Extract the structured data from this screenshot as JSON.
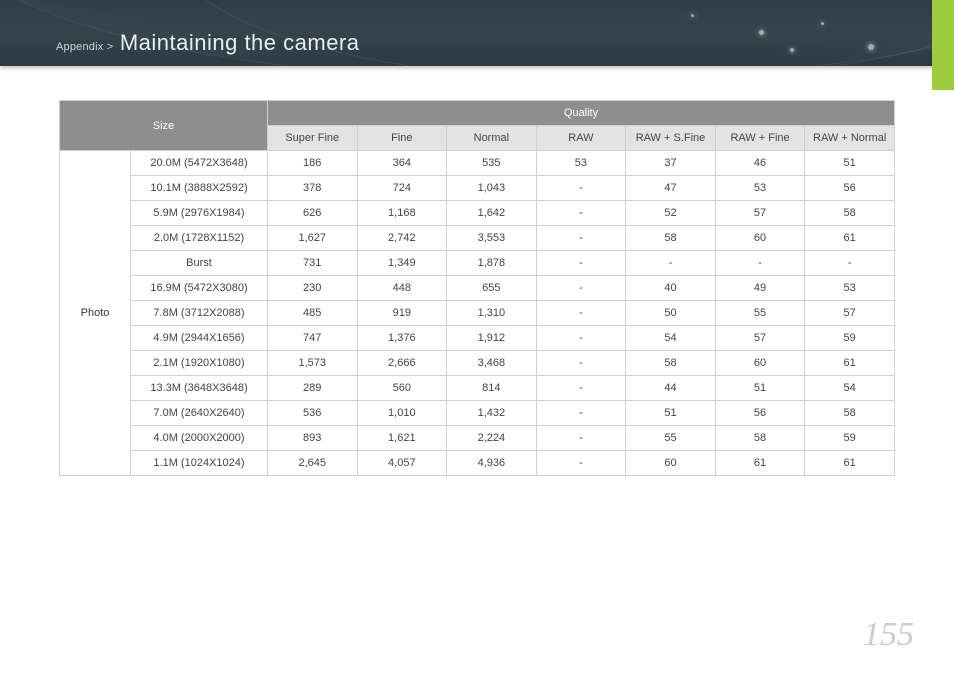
{
  "header": {
    "breadcrumb_prefix": "Appendix >",
    "title": "Maintaining the camera"
  },
  "page_number": "155",
  "table": {
    "size_header": "Size",
    "quality_header": "Quality",
    "quality_cols": [
      "Super Fine",
      "Fine",
      "Normal",
      "RAW",
      "RAW + S.Fine",
      "RAW + Fine",
      "RAW + Normal"
    ],
    "category": "Photo",
    "rows": [
      {
        "size": "20.0M (5472X3648)",
        "v": [
          "186",
          "364",
          "535",
          "53",
          "37",
          "46",
          "51"
        ]
      },
      {
        "size": "10.1M (3888X2592)",
        "v": [
          "378",
          "724",
          "1,043",
          "-",
          "47",
          "53",
          "56"
        ]
      },
      {
        "size": "5.9M (2976X1984)",
        "v": [
          "626",
          "1,168",
          "1,642",
          "-",
          "52",
          "57",
          "58"
        ]
      },
      {
        "size": "2.0M (1728X1152)",
        "v": [
          "1,627",
          "2,742",
          "3,553",
          "-",
          "58",
          "60",
          "61"
        ]
      },
      {
        "size": "Burst",
        "v": [
          "731",
          "1,349",
          "1,878",
          "-",
          "-",
          "-",
          "-"
        ]
      },
      {
        "size": "16.9M (5472X3080)",
        "v": [
          "230",
          "448",
          "655",
          "-",
          "40",
          "49",
          "53"
        ]
      },
      {
        "size": "7.8M (3712X2088)",
        "v": [
          "485",
          "919",
          "1,310",
          "-",
          "50",
          "55",
          "57"
        ]
      },
      {
        "size": "4.9M (2944X1656)",
        "v": [
          "747",
          "1,376",
          "1,912",
          "-",
          "54",
          "57",
          "59"
        ]
      },
      {
        "size": "2.1M (1920X1080)",
        "v": [
          "1,573",
          "2,666",
          "3,468",
          "-",
          "58",
          "60",
          "61"
        ]
      },
      {
        "size": "13.3M (3648X3648)",
        "v": [
          "289",
          "560",
          "814",
          "-",
          "44",
          "51",
          "54"
        ]
      },
      {
        "size": "7.0M (2640X2640)",
        "v": [
          "536",
          "1,010",
          "1,432",
          "-",
          "51",
          "56",
          "58"
        ]
      },
      {
        "size": "4.0M (2000X2000)",
        "v": [
          "893",
          "1,621",
          "2,224",
          "-",
          "55",
          "58",
          "59"
        ]
      },
      {
        "size": "1.1M (1024X1024)",
        "v": [
          "2,645",
          "4,057",
          "4,936",
          "-",
          "60",
          "61",
          "61"
        ]
      }
    ]
  }
}
